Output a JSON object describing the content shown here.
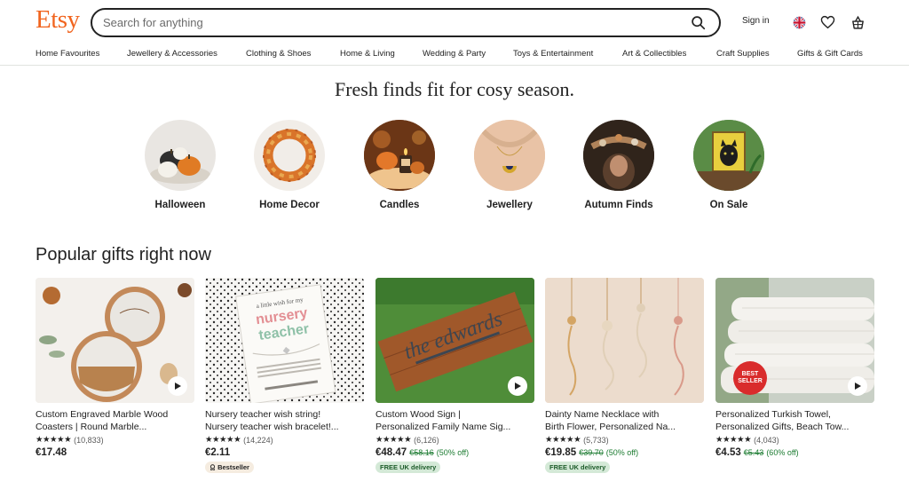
{
  "header": {
    "logo": "Etsy",
    "search_placeholder": "Search for anything",
    "signin_label": "Sign in"
  },
  "nav": [
    "Home Favourites",
    "Jewellery & Accessories",
    "Clothing & Shoes",
    "Home & Living",
    "Wedding & Party",
    "Toys & Entertainment",
    "Art & Collectibles",
    "Craft Supplies",
    "Gifts & Gift Cards"
  ],
  "hero": {
    "title": "Fresh finds fit for cosy season.",
    "circles": [
      "Halloween",
      "Home Decor",
      "Candles",
      "Jewellery",
      "Autumn Finds",
      "On Sale"
    ]
  },
  "popular": {
    "title": "Popular gifts right now",
    "items": [
      {
        "title1": "Custom Engraved Marble Wood",
        "title2": "Coasters | Round Marble...",
        "stars": "★★★★★",
        "count": "(10,833)",
        "price": "€17.48",
        "orig": "",
        "off": "",
        "badge": ""
      },
      {
        "title1": "Nursery teacher wish string!",
        "title2": "Nursery teacher wish bracelet!...",
        "stars": "★★★★★",
        "count": "(14,224)",
        "price": "€2.11",
        "orig": "",
        "off": "",
        "badge": "Bestseller"
      },
      {
        "title1": "Custom Wood Sign |",
        "title2": "Personalized Family Name Sig...",
        "stars": "★★★★★",
        "count": "(6,126)",
        "price": "€48.47",
        "orig": "€58.16",
        "off": "(50% off)",
        "badge": "FREE UK delivery"
      },
      {
        "title1": "Dainty Name Necklace with",
        "title2": "Birth Flower, Personalized Na...",
        "stars": "★★★★★",
        "count": "(5,733)",
        "price": "€19.85",
        "orig": "€39.70",
        "off": "(50% off)",
        "badge": "FREE UK delivery"
      },
      {
        "title1": "Personalized Turkish Towel,",
        "title2": "Personalized Gifts, Beach Tow...",
        "stars": "★★★★★",
        "count": "(4,043)",
        "price": "€4.53",
        "orig": "€5.43",
        "off": "(60% off)",
        "badge": ""
      }
    ]
  },
  "image_text": {
    "best_seller_sticker": "BEST SELLER",
    "wish_card": "a little wish for my nursery teacher",
    "wood_sign": "the edwards"
  },
  "colors": {
    "brand": "#F1641E",
    "sale_green": "#1d7c32",
    "delivery_badge_bg": "#d4e9d7"
  }
}
